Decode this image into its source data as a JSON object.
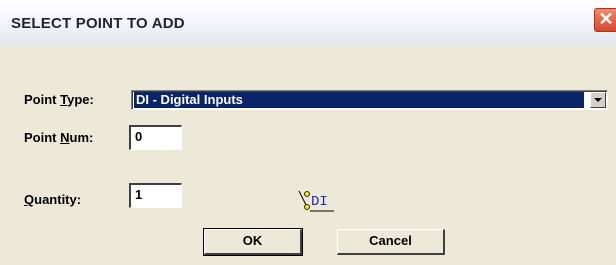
{
  "dialog": {
    "title": "SELECT POINT TO ADD",
    "close_glyph": "✕"
  },
  "fields": {
    "point_type": {
      "label_pre": "Point ",
      "label_accel": "T",
      "label_post": "ype:",
      "value": "DI - Digital Inputs"
    },
    "point_num": {
      "label_pre": "Point ",
      "label_accel": "N",
      "label_post": "um:",
      "value": "0"
    },
    "quantity": {
      "label_pre": "",
      "label_accel": "Q",
      "label_post": "uantity:",
      "value": "1"
    }
  },
  "icon": {
    "name": "digital-input-switch-icon",
    "text": "DI"
  },
  "buttons": {
    "ok": "OK",
    "cancel": "Cancel"
  }
}
